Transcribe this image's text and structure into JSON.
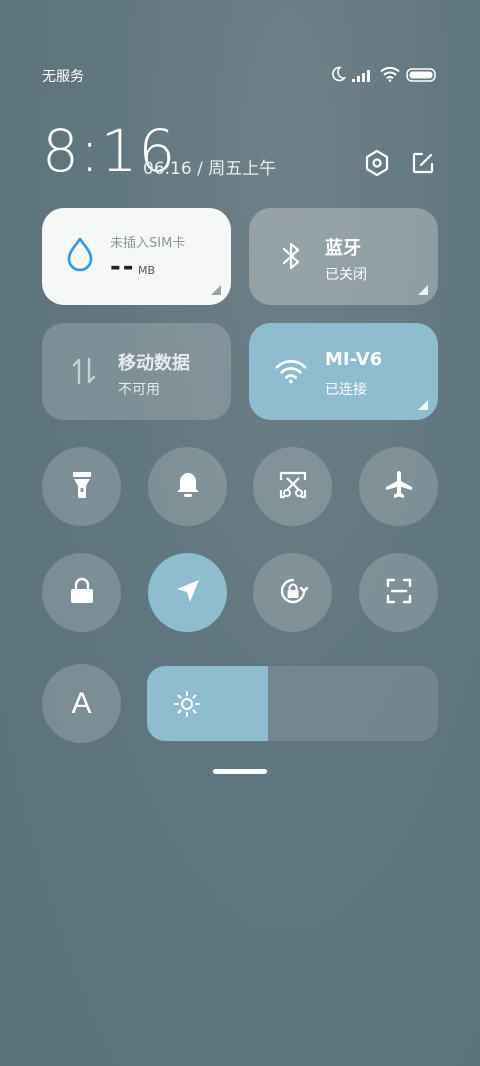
{
  "status_bar": {
    "carrier": "无服务",
    "icons": [
      "moon-icon",
      "signal-icon",
      "wifi-icon",
      "battery-icon"
    ]
  },
  "header": {
    "time": "8:16",
    "date": "06.16 / 周五上午",
    "settings_icon": "settings-hexagon-icon",
    "edit_icon": "edit-icon"
  },
  "tiles": {
    "data": {
      "title": "未插入SIM卡",
      "value": "--",
      "unit": "MB",
      "icon": "water-drop-icon",
      "accent": "#2d9be0"
    },
    "bluetooth": {
      "title": "蓝牙",
      "status": "已关闭",
      "icon": "bluetooth-icon"
    },
    "mobile_data": {
      "title": "移动数据",
      "status": "不可用",
      "icon": "data-arrows-icon"
    },
    "wifi": {
      "title": "MI-V6",
      "status": "已连接",
      "icon": "wifi-icon"
    }
  },
  "toggles_row1": [
    {
      "name": "flashlight",
      "icon": "flashlight-icon",
      "active": false
    },
    {
      "name": "ring",
      "icon": "bell-icon",
      "active": false
    },
    {
      "name": "screenshot",
      "icon": "scissors-icon",
      "active": false
    },
    {
      "name": "airplane",
      "icon": "airplane-icon",
      "active": false
    }
  ],
  "toggles_row2": [
    {
      "name": "lock",
      "icon": "lock-icon",
      "active": false
    },
    {
      "name": "location",
      "icon": "location-arrow-icon",
      "active": true
    },
    {
      "name": "rotation-lock",
      "icon": "rotation-lock-icon",
      "active": false
    },
    {
      "name": "scanner",
      "icon": "scan-icon",
      "active": false
    }
  ],
  "auto_brightness": {
    "label": "A",
    "icon": "font-a-icon"
  },
  "brightness": {
    "level": 0.415,
    "icon": "sun-icon"
  },
  "colors": {
    "accent": "#8fbccf",
    "tile_inactive": "rgba(255,255,255,0.18)"
  }
}
